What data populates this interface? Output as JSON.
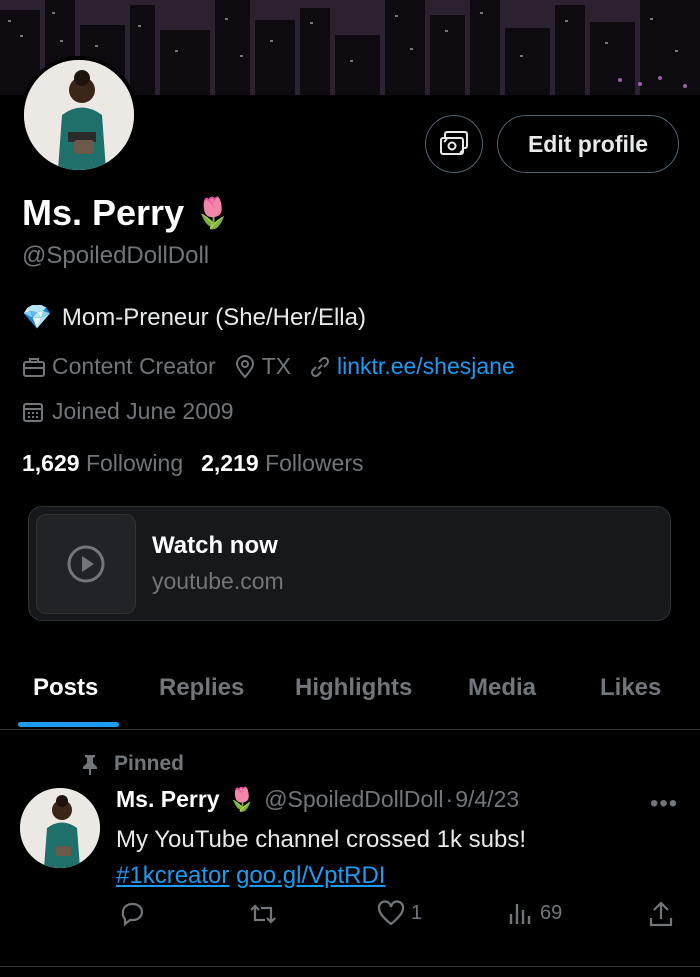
{
  "profile": {
    "name": "Ms. Perry",
    "name_emoji": "🌷",
    "handle": "@SpoiledDollDoll",
    "edit_label": "Edit profile",
    "bio_emoji": "💎",
    "bio": "Mom-Preneur (She/Her/Ella)",
    "category": "Content Creator",
    "location": "TX",
    "website": "linktr.ee/shesjane",
    "joined": "Joined June 2009",
    "following_count": "1,629",
    "following_label": "Following",
    "followers_count": "2,219",
    "followers_label": "Followers"
  },
  "card": {
    "title": "Watch now",
    "domain": "youtube.com"
  },
  "tabs": [
    {
      "label": "Posts",
      "active": true
    },
    {
      "label": "Replies"
    },
    {
      "label": "Highlights"
    },
    {
      "label": "Media"
    },
    {
      "label": "Likes"
    }
  ],
  "post": {
    "pinned_label": "Pinned",
    "author_name": "Ms. Perry",
    "author_emoji": "🌷",
    "author_handle": "@SpoiledDollDoll",
    "separator": "·",
    "date": "9/4/23",
    "more": "•••",
    "text": "My YouTube channel crossed 1k subs!",
    "hashtag": "#1kcreator",
    "link": "goo.gl/VptRDI",
    "likes": "1",
    "views": "69"
  },
  "colors": {
    "accent": "#1d9bf0",
    "muted": "#71767b",
    "border": "#2f3336"
  }
}
